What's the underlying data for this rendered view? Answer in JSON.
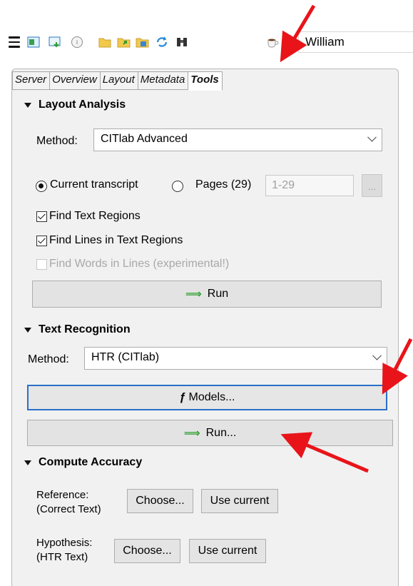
{
  "toolbar": {
    "icons": [
      "menu-icon",
      "image-icon",
      "download-icon",
      "info-icon",
      "folder-icon",
      "open-folder-icon",
      "save-icon",
      "refresh-icon",
      "binoculars-icon",
      "coffee-icon"
    ],
    "user_name": "William"
  },
  "tabs": [
    {
      "label": "Server"
    },
    {
      "label": "Overview"
    },
    {
      "label": "Layout"
    },
    {
      "label": "Metadata"
    },
    {
      "label": "Tools",
      "active": true
    }
  ],
  "layout_analysis": {
    "header": "Layout Analysis",
    "method_label": "Method:",
    "method_value": "CITlab Advanced",
    "radio_current": "Current transcript",
    "radio_pages": "Pages (29)",
    "pages_value": "1-29",
    "dots_label": "...",
    "find_text_regions": "Find Text Regions",
    "find_lines": "Find Lines in Text Regions",
    "find_words": "Find Words in Lines (experimental!)",
    "run_label": "Run"
  },
  "text_recognition": {
    "header": "Text Recognition",
    "method_label": "Method:",
    "method_value": "HTR (CITlab)",
    "models_label": "Models...",
    "run_label": "Run..."
  },
  "compute_accuracy": {
    "header": "Compute Accuracy",
    "reference_label_1": "Reference:",
    "reference_label_2": "(Correct Text)",
    "hypothesis_label_1": "Hypothesis:",
    "hypothesis_label_2": "(HTR Text)",
    "choose_label": "Choose...",
    "use_current_label": "Use current"
  },
  "colors": {
    "annotation_arrow": "#e8141a",
    "focus_border": "#2a70c9",
    "run_arrow": "#2f9e2f"
  }
}
